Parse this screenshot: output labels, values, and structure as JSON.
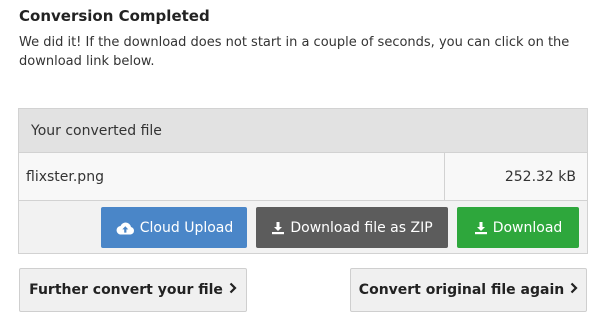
{
  "header": {
    "title": "Conversion Completed",
    "message": "We did it! If the download does not start in a couple of seconds, you can click on the download link below."
  },
  "file_table": {
    "header": "Your converted file",
    "file_name": "flixster.png",
    "file_size": "252.32 kB"
  },
  "buttons": {
    "cloud_upload": "Cloud Upload",
    "download_zip": "Download file as ZIP",
    "download": "Download",
    "further_convert": "Further convert your file",
    "convert_again": "Convert original file again"
  },
  "icons": {
    "cloud_upload": "cloud-upload-icon",
    "download_zip": "download-icon",
    "download": "download-icon",
    "further_convert": "chevron-right-icon",
    "convert_again": "chevron-right-icon"
  },
  "colors": {
    "cloud_upload": "#4a86c8",
    "download_zip": "#5c5c5c",
    "download": "#2ea73c"
  }
}
